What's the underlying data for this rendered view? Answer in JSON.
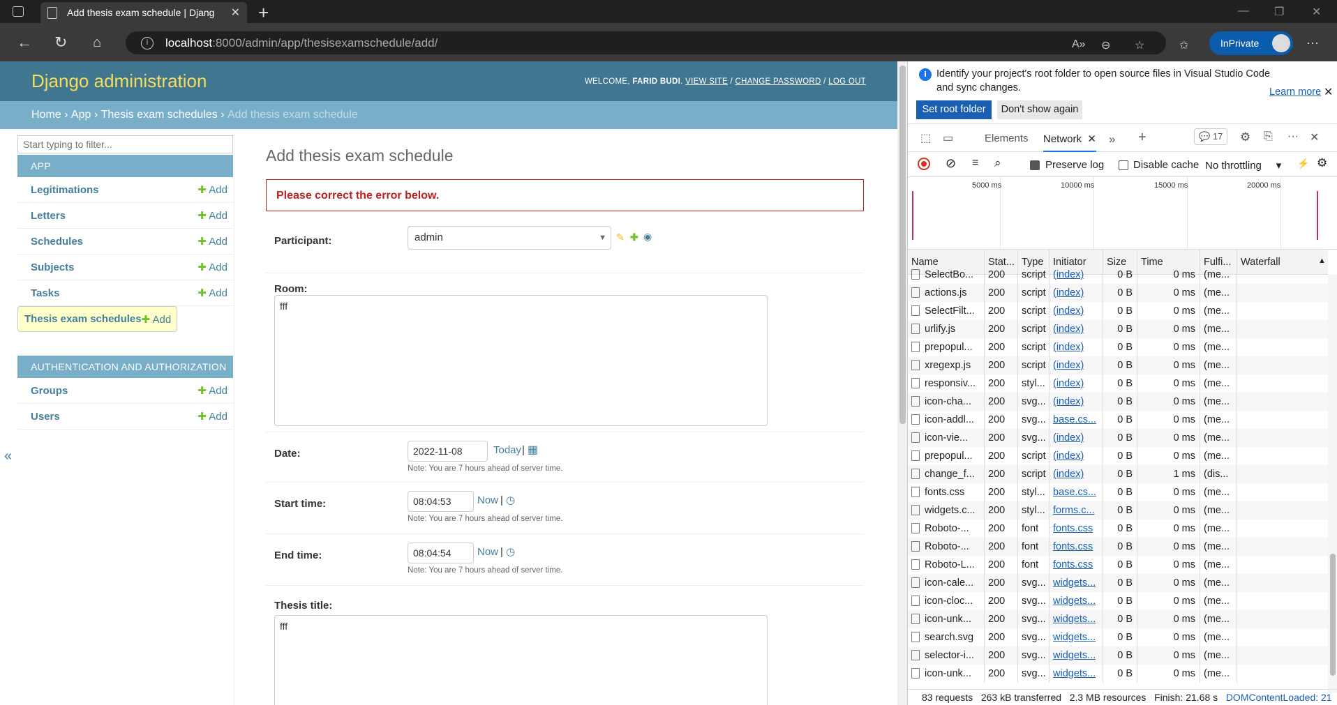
{
  "browser": {
    "tab_title": "Add thesis exam schedule | Djang",
    "url_host": "localhost",
    "url_path": ":8000/admin/app/thesisexamschedule/add/",
    "inprivate_label": "InPrivate"
  },
  "django": {
    "branding": "Django administration",
    "welcome": "WELCOME,",
    "user": "FARID BUDI",
    "view_site": "VIEW SITE",
    "change_password": "CHANGE PASSWORD",
    "log_out": "LOG OUT",
    "sep": "/",
    "breadcrumbs": [
      "Home",
      "App",
      "Thesis exam schedules",
      "Add thesis exam schedule"
    ],
    "filter_placeholder": "Start typing to filter...",
    "collapse": "«",
    "app_module": {
      "title": "APP",
      "items": [
        "Legitimations",
        "Letters",
        "Schedules",
        "Subjects",
        "Tasks",
        "Thesis exam schedules"
      ]
    },
    "auth_module": {
      "title": "AUTHENTICATION AND AUTHORIZATION",
      "items": [
        "Groups",
        "Users"
      ]
    },
    "add_label": "Add",
    "page_title": "Add thesis exam schedule",
    "error_note": "Please correct the error below.",
    "fields": {
      "participant_label": "Participant:",
      "participant_value": "admin",
      "room_label": "Room:",
      "room_value": "fff",
      "date_label": "Date:",
      "date_value": "2022-11-08",
      "today": "Today",
      "start_label": "Start time:",
      "start_value": "08:04:53",
      "end_label": "End time:",
      "end_value": "08:04:54",
      "now": "Now",
      "bar": "|",
      "note": "Note: You are 7 hours ahead of server time.",
      "thesis_label": "Thesis title:",
      "thesis_value": "fff"
    }
  },
  "devtools": {
    "info_message": "Identify your project's root folder to open source files in Visual Studio Code and sync changes.",
    "learn_more": "Learn more",
    "set_root": "Set root folder",
    "dont_show": "Don't show again",
    "tabs": {
      "elements": "Elements",
      "network": "Network",
      "issues": "17"
    },
    "preserve_log": "Preserve log",
    "disable_cache": "Disable cache",
    "throttling": "No throttling",
    "ticks": [
      "5000 ms",
      "10000 ms",
      "15000 ms",
      "20000 ms"
    ],
    "columns": [
      "Name",
      "Stat...",
      "Type",
      "Initiator",
      "Size",
      "Time",
      "Fulfi...",
      "Waterfall"
    ],
    "rows": [
      [
        "SelectBo...",
        "200",
        "script",
        "(index)",
        "0 B",
        "0 ms",
        "(me..."
      ],
      [
        "actions.js",
        "200",
        "script",
        "(index)",
        "0 B",
        "0 ms",
        "(me..."
      ],
      [
        "SelectFilt...",
        "200",
        "script",
        "(index)",
        "0 B",
        "0 ms",
        "(me..."
      ],
      [
        "urlify.js",
        "200",
        "script",
        "(index)",
        "0 B",
        "0 ms",
        "(me..."
      ],
      [
        "prepopul...",
        "200",
        "script",
        "(index)",
        "0 B",
        "0 ms",
        "(me..."
      ],
      [
        "xregexp.js",
        "200",
        "script",
        "(index)",
        "0 B",
        "0 ms",
        "(me..."
      ],
      [
        "responsiv...",
        "200",
        "styl...",
        "(index)",
        "0 B",
        "0 ms",
        "(me..."
      ],
      [
        "icon-cha...",
        "200",
        "svg...",
        "(index)",
        "0 B",
        "0 ms",
        "(me..."
      ],
      [
        "icon-addl...",
        "200",
        "svg...",
        "base.cs...",
        "0 B",
        "0 ms",
        "(me..."
      ],
      [
        "icon-vie...",
        "200",
        "svg...",
        "(index)",
        "0 B",
        "0 ms",
        "(me..."
      ],
      [
        "prepopul...",
        "200",
        "script",
        "(index)",
        "0 B",
        "0 ms",
        "(me..."
      ],
      [
        "change_f...",
        "200",
        "script",
        "(index)",
        "0 B",
        "1 ms",
        "(dis..."
      ],
      [
        "fonts.css",
        "200",
        "styl...",
        "base.cs...",
        "0 B",
        "0 ms",
        "(me..."
      ],
      [
        "widgets.c...",
        "200",
        "styl...",
        "forms.c...",
        "0 B",
        "0 ms",
        "(me..."
      ],
      [
        "Roboto-...",
        "200",
        "font",
        "fonts.css",
        "0 B",
        "0 ms",
        "(me..."
      ],
      [
        "Roboto-...",
        "200",
        "font",
        "fonts.css",
        "0 B",
        "0 ms",
        "(me..."
      ],
      [
        "Roboto-L...",
        "200",
        "font",
        "fonts.css",
        "0 B",
        "0 ms",
        "(me..."
      ],
      [
        "icon-cale...",
        "200",
        "svg...",
        "widgets...",
        "0 B",
        "0 ms",
        "(me..."
      ],
      [
        "icon-cloc...",
        "200",
        "svg...",
        "widgets...",
        "0 B",
        "0 ms",
        "(me..."
      ],
      [
        "icon-unk...",
        "200",
        "svg...",
        "widgets...",
        "0 B",
        "0 ms",
        "(me..."
      ],
      [
        "search.svg",
        "200",
        "svg...",
        "widgets...",
        "0 B",
        "0 ms",
        "(me..."
      ],
      [
        "selector-i...",
        "200",
        "svg...",
        "widgets...",
        "0 B",
        "0 ms",
        "(me..."
      ],
      [
        "icon-unk...",
        "200",
        "svg...",
        "widgets...",
        "0 B",
        "0 ms",
        "(me..."
      ]
    ],
    "summary": {
      "requests": "83 requests",
      "transferred": "263 kB transferred",
      "resources": "2.3 MB resources",
      "finish": "Finish: 21.68 s",
      "dcl": "DOMContentLoaded: 21"
    }
  },
  "colors": {
    "django_header": "#417690",
    "breadcrumbs": "#79aec8",
    "branding": "#f5dd5d",
    "error": "#ba2121",
    "link": "#447e9b",
    "add_green": "#70bf2b",
    "devtools_accent": "#1a5fb4"
  }
}
